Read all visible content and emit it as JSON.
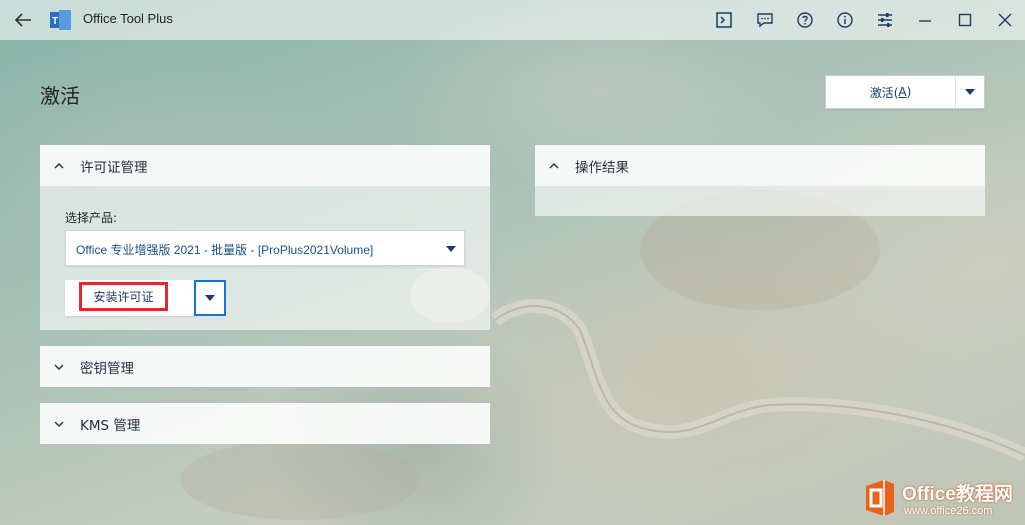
{
  "app": {
    "title": "Office Tool Plus"
  },
  "titlebar": {
    "icons": [
      "back-arrow-icon",
      "app-logo-icon",
      "terminal-icon",
      "feedback-icon",
      "help-icon",
      "info-icon",
      "settings-sliders-icon",
      "minimize-icon",
      "maximize-icon",
      "close-icon"
    ]
  },
  "page": {
    "title": "激活"
  },
  "activate": {
    "label_prefix": "激活(",
    "label_key": "A",
    "label_suffix": ")"
  },
  "license_panel": {
    "title": "许可证管理",
    "select_label": "选择产品:",
    "selected_product": "Office 专业增强版 2021 - 批量版 - [ProPlus2021Volume]",
    "install_label": "安装许可证"
  },
  "result_panel": {
    "title": "操作结果"
  },
  "key_panel": {
    "title": "密钥管理"
  },
  "kms_panel": {
    "title": "KMS 管理"
  },
  "watermark": {
    "title": "Office教程网",
    "url": "www.office26.com",
    "logo_color": "#e8641c"
  },
  "colors": {
    "accent": "#1a73c9",
    "highlight": "#e02a2a"
  }
}
